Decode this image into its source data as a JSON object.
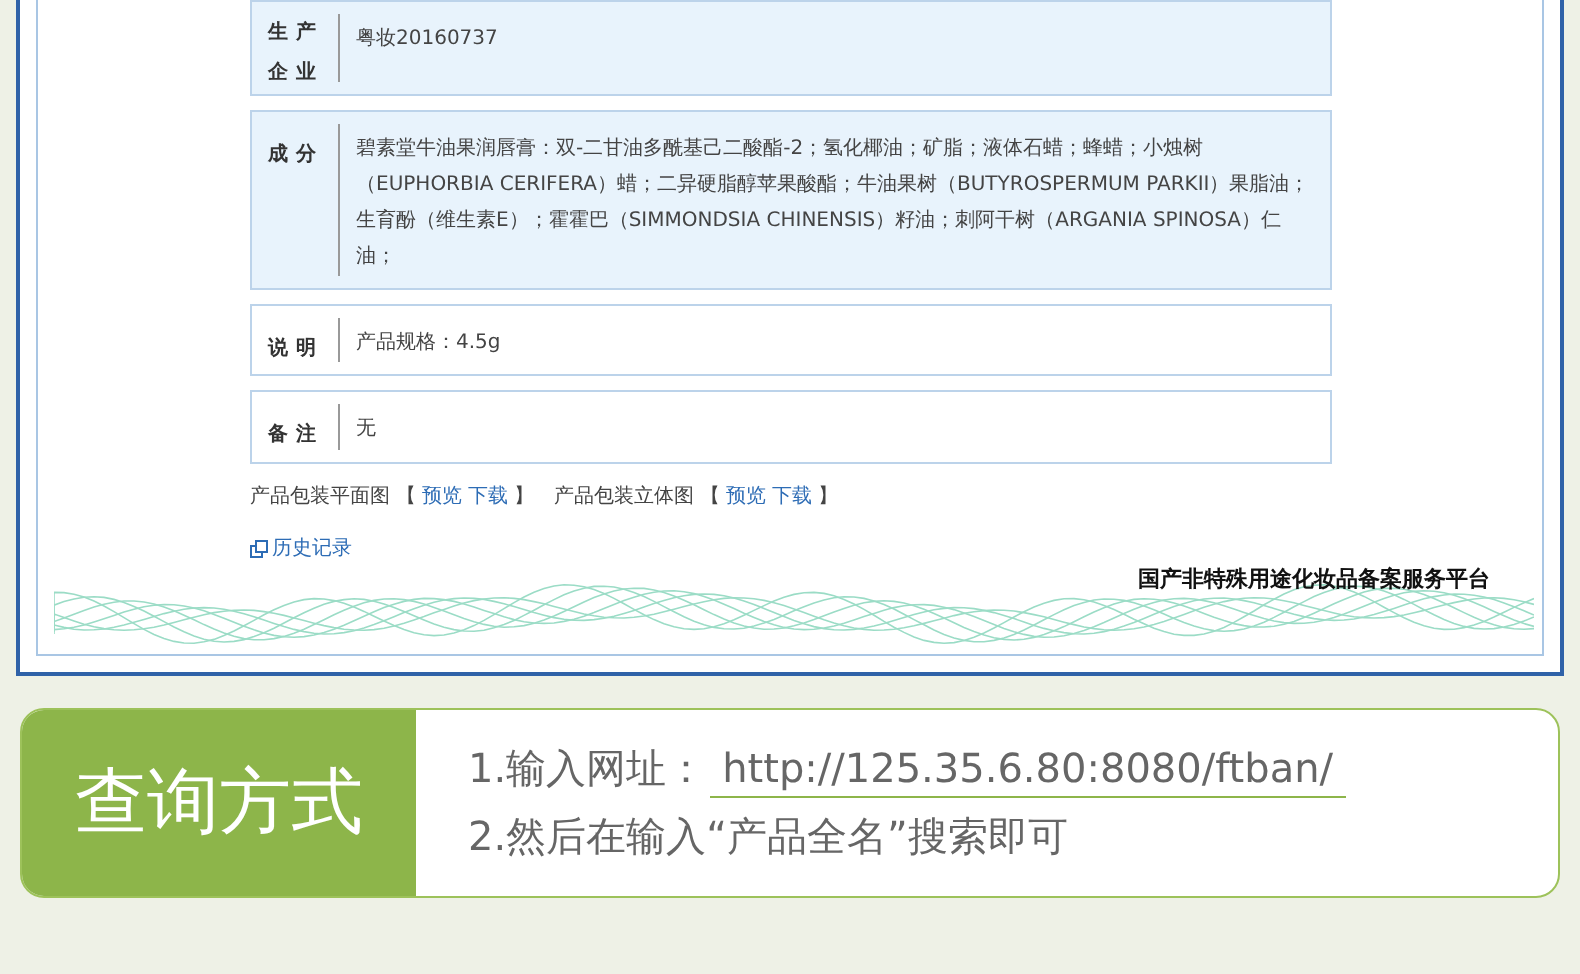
{
  "certificate": {
    "fields": [
      {
        "label": "生产企业",
        "value": "粤妆20160737"
      },
      {
        "label": "成分",
        "value": "碧素堂牛油果润唇膏：双-二甘油多酰基己二酸酯-2；氢化椰油；矿脂；液体石蜡；蜂蜡；小烛树（EUPHORBIA CERIFERA）蜡；二异硬脂醇苹果酸酯；牛油果树（BUTYROSPERMUM PARKII）果脂油；生育酚（维生素E）；霍霍巴（SIMMONDSIA CHINENSIS）籽油；刺阿干树（ARGANIA SPINOSA）仁油；"
      },
      {
        "label": "说明",
        "value": "产品规格：4.5g"
      },
      {
        "label": "备注",
        "value": "无"
      }
    ],
    "package_images": [
      {
        "label": "产品包装平面图",
        "open": "【",
        "links": [
          "预览",
          "下载"
        ],
        "close": "】"
      },
      {
        "label": "产品包装立体图",
        "open": "【",
        "links": [
          "预览",
          "下载"
        ],
        "close": "】"
      }
    ],
    "history_link": "历史记录",
    "platform_name": "国产非特殊用途化妆品备案服务平台"
  },
  "query": {
    "title": "查询方式",
    "steps": [
      {
        "prefix": "1.输入网址：",
        "url": "http://125.35.6.80:8080/ftban/"
      },
      {
        "prefix": "2.然后在输入“产品全名”搜索即可"
      }
    ]
  }
}
